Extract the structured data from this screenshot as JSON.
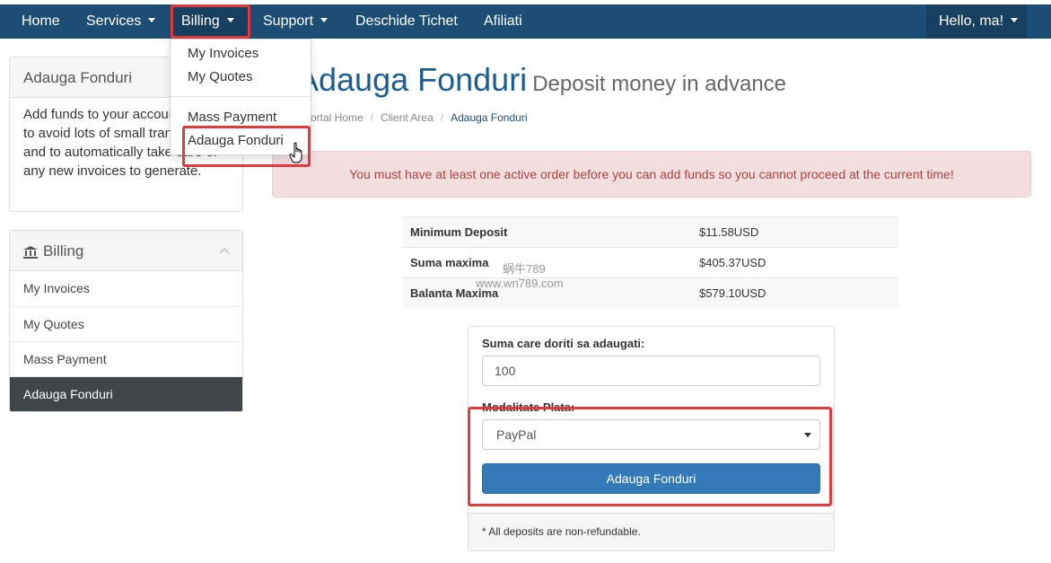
{
  "nav": {
    "home": "Home",
    "services": "Services",
    "billing": "Billing",
    "support": "Support",
    "ticket": "Deschide Tichet",
    "affiliates": "Afiliati",
    "user": "Hello, ma!"
  },
  "billing_dropdown": {
    "items": [
      "My Invoices",
      "My Quotes",
      "Mass Payment",
      "Adauga Fonduri"
    ]
  },
  "sidebar": {
    "info_title": "Adauga Fonduri",
    "info_body": "Add funds to your account with us to avoid lots of small transactions and to automatically take care of any new invoices to generate.",
    "billing_title": "Billing",
    "billing_items": [
      "My Invoices",
      "My Quotes",
      "Mass Payment",
      "Adauga Fonduri"
    ]
  },
  "page": {
    "title": "Adauga Fonduri",
    "subtitle": "Deposit money in advance",
    "breadcrumb": [
      "Portal Home",
      "Client Area",
      "Adauga Fonduri"
    ]
  },
  "alert": "You must have at least one active order before you can add funds so you cannot proceed at the current time!",
  "deposit_table": [
    {
      "label": "Minimum Deposit",
      "value": "$11.58USD"
    },
    {
      "label": "Suma maxima",
      "value": "$405.37USD"
    },
    {
      "label": "Balanta Maxima",
      "value": "$579.10USD"
    }
  ],
  "form": {
    "amount_label": "Suma care doriti sa adaugati:",
    "amount_value": "100",
    "method_label": "Modalitate Plata:",
    "method_value": "PayPal",
    "submit": "Adauga Fonduri",
    "footer": "* All deposits are non-refundable."
  },
  "watermark": {
    "line1": "蜗牛789",
    "line2": "www.wn789.com"
  },
  "colors": {
    "navbar": "#1c4e75",
    "highlight": "#e0393e",
    "primary": "#337ab7",
    "alert_bg": "#f2dede",
    "alert_text": "#a94442"
  }
}
